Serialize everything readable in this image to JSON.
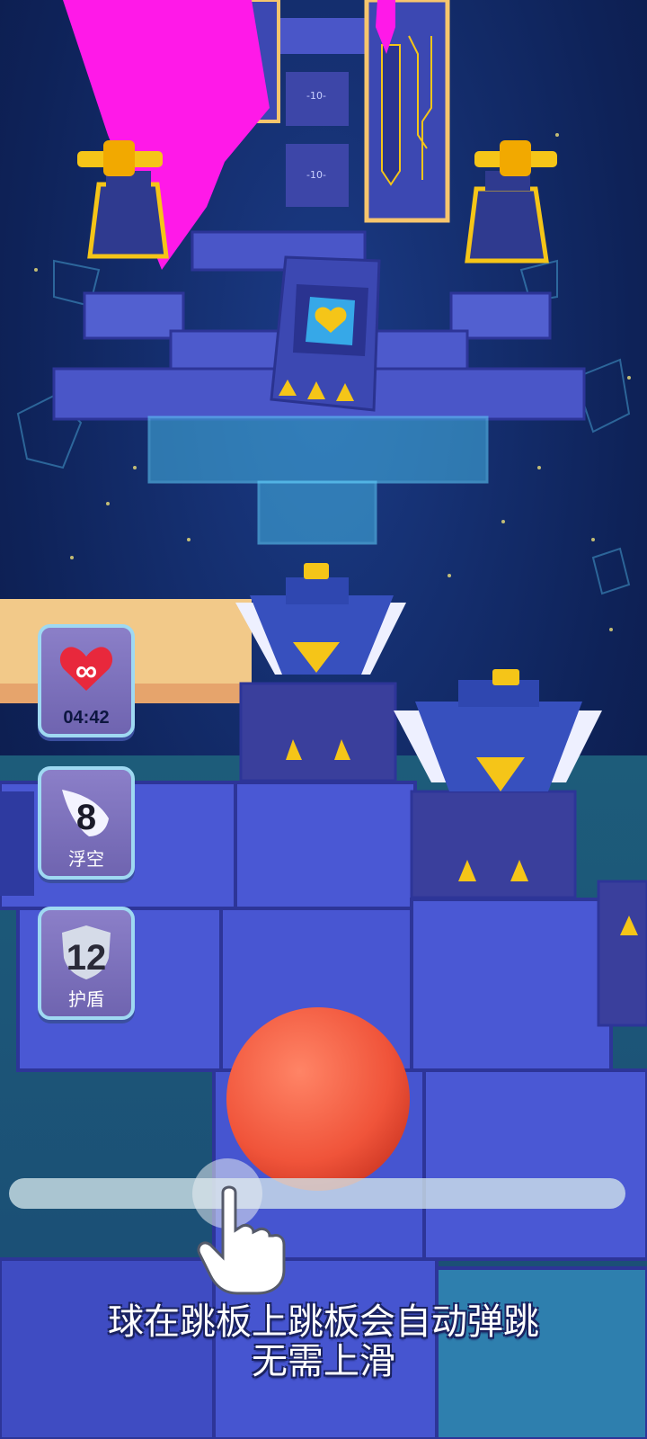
{
  "hud": {
    "lives": {
      "icon": "infinity-heart-icon",
      "infinity": "∞",
      "timer": "04:42"
    },
    "float": {
      "icon": "wing-icon",
      "count": "8",
      "label": "浮空"
    },
    "shield": {
      "icon": "shield-icon",
      "count": "12",
      "label": "护盾"
    }
  },
  "tutorial": {
    "line1": "球在跳板上跳板会自动弹跳",
    "line2": "无需上滑",
    "slider": {
      "icon": "hand-pointer-icon"
    }
  },
  "board": {
    "tile_labels": [
      "-10-",
      "-10-"
    ]
  },
  "colors": {
    "background": "#0d1e4f",
    "tile": "#4a56c8",
    "ball": "#f0543a",
    "magenta": "#ff19e8",
    "gold": "#f5c518",
    "hud_card": "#7a6fbd"
  }
}
